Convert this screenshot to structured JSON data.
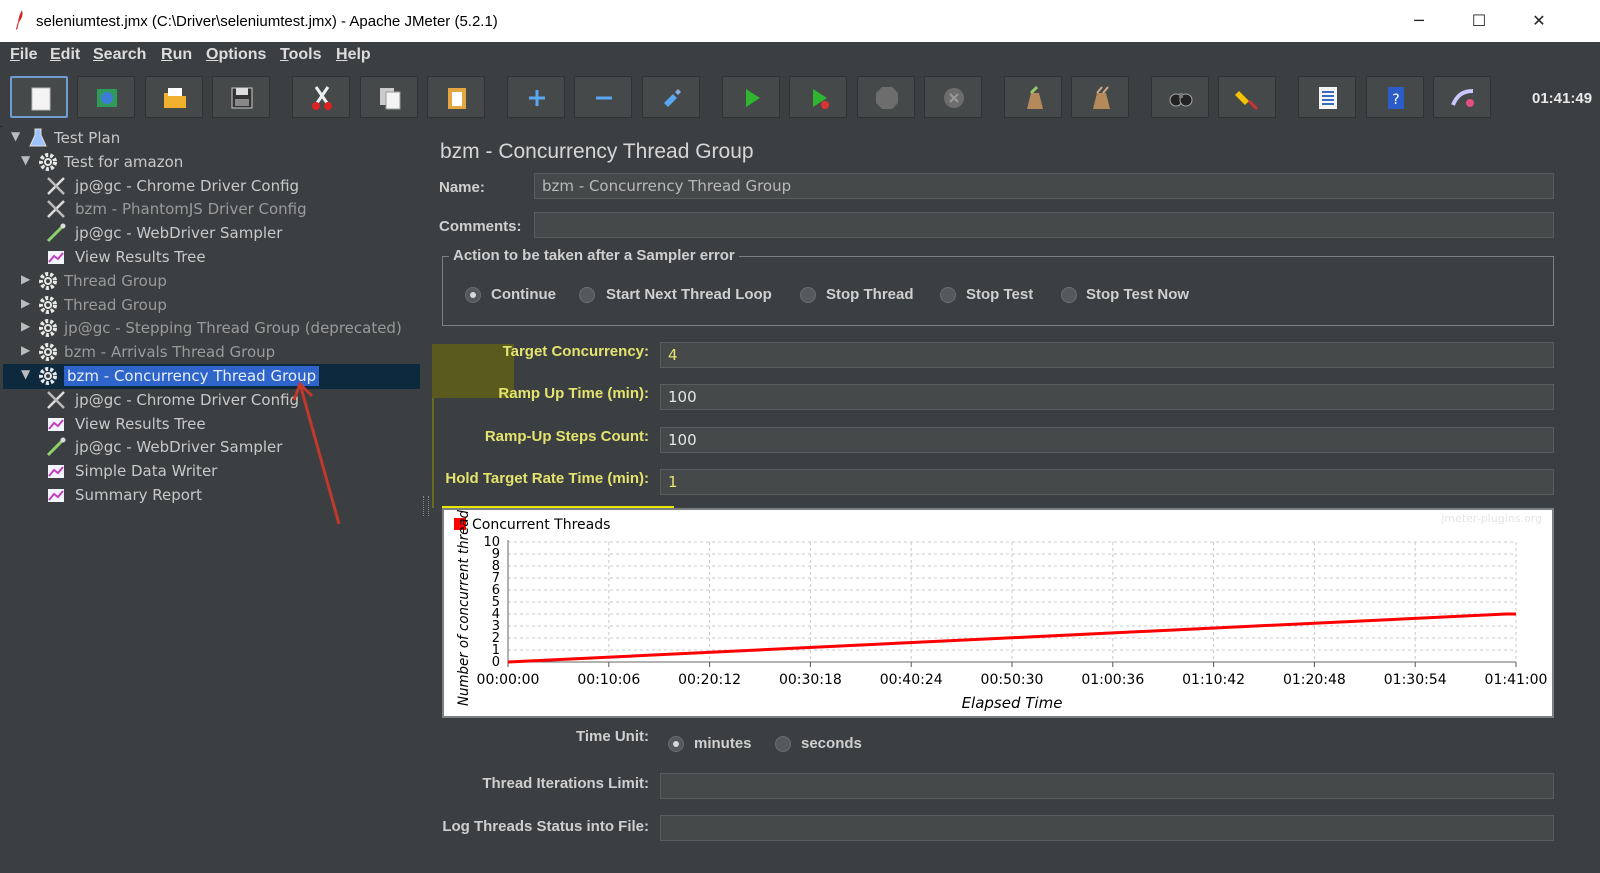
{
  "window": {
    "title": "seleniumtest.jmx (C:\\Driver\\seleniumtest.jmx) - Apache JMeter (5.2.1)",
    "minimize": "─",
    "maximize": "☐",
    "close": "✕"
  },
  "menu": [
    "File",
    "Edit",
    "Search",
    "Run",
    "Options",
    "Tools",
    "Help"
  ],
  "toolbar": {
    "icons": [
      "new-icon",
      "templates-icon",
      "open-icon",
      "save-icon",
      "cut-icon",
      "copy-icon",
      "paste-icon",
      "expand-icon",
      "collapse-icon",
      "toggle-icon",
      "start-icon",
      "start-no-pause-icon",
      "stop-icon",
      "shutdown-icon",
      "clear-icon",
      "clear-all-icon",
      "search-icon",
      "reset-search-icon",
      "function-helper-icon",
      "help-icon",
      "remote-icon"
    ],
    "clock": "01:41:49"
  },
  "tree": [
    {
      "label": "Test Plan",
      "icon": "flask-icon",
      "level": 0,
      "toggle": "▼",
      "dim": false
    },
    {
      "label": "Test for amazon",
      "icon": "gear-icon",
      "level": 1,
      "toggle": "▼",
      "dim": false
    },
    {
      "label": "jp@gc - Chrome Driver Config",
      "icon": "tools-icon",
      "level": 2,
      "toggle": "",
      "dim": false
    },
    {
      "label": "bzm - PhantomJS Driver Config",
      "icon": "tools-icon",
      "level": 2,
      "toggle": "",
      "dim": true
    },
    {
      "label": "jp@gc - WebDriver Sampler",
      "icon": "pipette-icon",
      "level": 2,
      "toggle": "",
      "dim": false
    },
    {
      "label": "View Results Tree",
      "icon": "graph-icon",
      "level": 2,
      "toggle": "",
      "dim": false
    },
    {
      "label": "Thread Group",
      "icon": "gear-icon",
      "level": 1,
      "toggle": "▶",
      "dim": true
    },
    {
      "label": "Thread Group",
      "icon": "gear-icon",
      "level": 1,
      "toggle": "▶",
      "dim": true
    },
    {
      "label": "jp@gc - Stepping Thread Group (deprecated)",
      "icon": "gear-icon",
      "level": 1,
      "toggle": "▶",
      "dim": true
    },
    {
      "label": "bzm - Arrivals Thread Group",
      "icon": "gear-icon",
      "level": 1,
      "toggle": "▶",
      "dim": true
    },
    {
      "label": "bzm - Concurrency Thread Group",
      "icon": "gear-icon",
      "level": 1,
      "toggle": "▼",
      "dim": false,
      "selected": true
    },
    {
      "label": "jp@gc - Chrome Driver Config",
      "icon": "tools-icon",
      "level": 2,
      "toggle": "",
      "dim": false
    },
    {
      "label": "View Results Tree",
      "icon": "graph-icon",
      "level": 2,
      "toggle": "",
      "dim": false
    },
    {
      "label": "jp@gc - WebDriver Sampler",
      "icon": "pipette-icon",
      "level": 2,
      "toggle": "",
      "dim": false
    },
    {
      "label": "Simple Data Writer",
      "icon": "graph-icon",
      "level": 2,
      "toggle": "",
      "dim": false
    },
    {
      "label": "Summary Report",
      "icon": "graph-icon",
      "level": 2,
      "toggle": "",
      "dim": false
    }
  ],
  "panel": {
    "title": "bzm - Concurrency Thread Group",
    "name_label": "Name:",
    "name_value": "bzm - Concurrency Thread Group",
    "comments_label": "Comments:",
    "comments_value": "",
    "error_action": {
      "legend": "Action to be taken after a Sampler error",
      "options": [
        "Continue",
        "Start Next Thread Loop",
        "Stop Thread",
        "Stop Test",
        "Stop Test Now"
      ],
      "selected": "Continue"
    },
    "target_concurrency_label": "Target Concurrency:",
    "target_concurrency": "4",
    "ramp_up_label": "Ramp Up Time (min):",
    "ramp_up": "100",
    "steps_label": "Ramp-Up Steps Count:",
    "steps": "100",
    "hold_label": "Hold Target Rate Time (min):",
    "hold": "1",
    "time_unit_label": "Time Unit:",
    "time_unit_options": [
      "minutes",
      "seconds"
    ],
    "time_unit_selected": "minutes",
    "iterations_label": "Thread Iterations Limit:",
    "iterations": "",
    "log_label": "Log Threads Status into File:",
    "log_file": ""
  },
  "chart_data": {
    "type": "line",
    "title": "",
    "legend": "Concurrent Threads",
    "watermark": "jmeter-plugins.org",
    "xlabel": "Elapsed Time",
    "ylabel": "Number of concurrent thread",
    "ylim": [
      0,
      10
    ],
    "yticks": [
      "0",
      "1",
      "2",
      "3",
      "4",
      "5",
      "6",
      "7",
      "8",
      "9",
      "10"
    ],
    "xticks": [
      "00:00:00",
      "00:10:06",
      "00:20:12",
      "00:30:18",
      "00:40:24",
      "00:50:30",
      "01:00:36",
      "01:10:42",
      "01:20:48",
      "01:30:54",
      "01:41:00"
    ],
    "series": [
      {
        "name": "Concurrent Threads",
        "color": "#ff0000",
        "x": [
          "00:00:00",
          "01:40:00",
          "01:41:00"
        ],
        "values": [
          0,
          4,
          4
        ]
      }
    ]
  },
  "colors": {
    "background": "#3c3f41",
    "selection": "#2f65ca",
    "highlight_label": "#e3e36e",
    "series": "#ff0000",
    "annotation_arrow": "#c0392b"
  }
}
